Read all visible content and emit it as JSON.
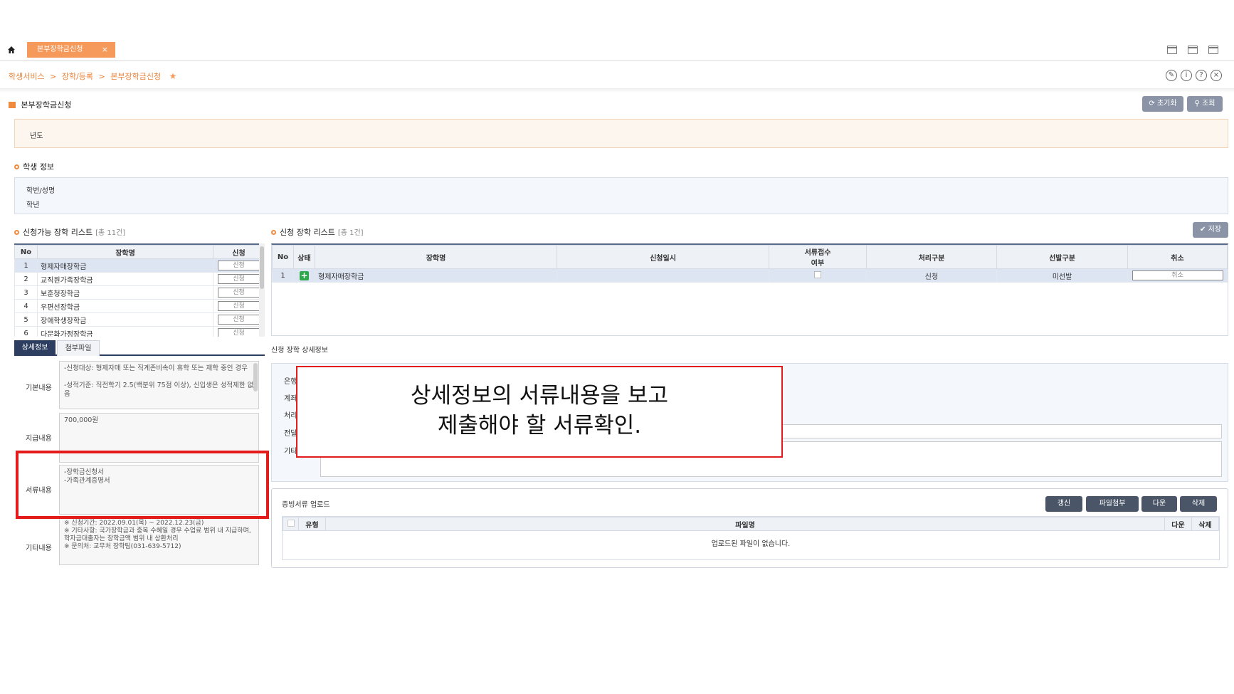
{
  "tabbar": {
    "home_icon": "home-icon",
    "active_tab": "본부장학금신청",
    "close_symbol": "×"
  },
  "breadcrumb": {
    "items": [
      "학생서비스",
      "장학/등록",
      "본부장학금신청"
    ],
    "separator": ">",
    "fav_symbol": "★"
  },
  "header_icons": {
    "edit": "✎",
    "info": "i",
    "help": "?",
    "close": "×"
  },
  "page": {
    "title": "본부장학금신청",
    "reset_button": "초기화",
    "search_button": "조회"
  },
  "search": {
    "year_label": "년도"
  },
  "student": {
    "section_title": "학생 정보",
    "id_name_label": "학번/성명",
    "grade_label": "학년"
  },
  "available_list": {
    "title": "신청가능 장학 리스트",
    "count": "[총 11건]",
    "headers": [
      "No",
      "장학명",
      "신청"
    ],
    "rows": [
      {
        "no": "1",
        "name": "형제자매장학금",
        "action": "신청"
      },
      {
        "no": "2",
        "name": "교직원가족장학금",
        "action": "신청"
      },
      {
        "no": "3",
        "name": "보훈청장학금",
        "action": "신청"
      },
      {
        "no": "4",
        "name": "우편선장학금",
        "action": "신청"
      },
      {
        "no": "5",
        "name": "장애학생장학금",
        "action": "신청"
      },
      {
        "no": "6",
        "name": "다문화가정장학금",
        "action": "신청"
      }
    ]
  },
  "applied_list": {
    "title": "신청 장학 리스트",
    "count": "[총 1건]",
    "save_button": "저장",
    "headers": {
      "no": "No",
      "status": "상태",
      "name": "장학명",
      "date": "신청일시",
      "doc_1": "서류접수",
      "doc_2": "여부",
      "process": "처리구분",
      "select": "선발구분",
      "cancel": "취소"
    },
    "rows": [
      {
        "no": "1",
        "name": "형제자매장학금",
        "date": "",
        "process": "신청",
        "select": "미선발",
        "cancel": "취소"
      }
    ]
  },
  "detail_tabs": {
    "detail": "상세정보",
    "attachment": "첨부파일"
  },
  "detail": {
    "basic_label": "기본내용",
    "basic_text": "-신청대상: 형제자매 또는 직계존비속이 휴학 또는 재학 중인 경우\n\n-성적기준: 직전학기 2.5(백분위 75점 이상), 신입생은 성적제한 없음",
    "pay_label": "지급내용",
    "pay_text": "700,000원",
    "doc_label": "서류내용",
    "doc_text": "-장학금신청서\n-가족관계증명서",
    "etc_label": "기타내용",
    "etc_text": "※ 신청기간: 2022.09.01(목) ~ 2022.12.23(금)\n※ 기타사항: 국가장학금과 중복 수혜일 경우 수업료 범위 내 지급하며, 학자금대출자는 장학금액 범위 내 상환처리\n※ 문의처: 교무처 장학팀(031-639-5712)"
  },
  "applied_detail": {
    "title": "신청 장학 상세정보",
    "labels": [
      "은행",
      "계좌",
      "처리",
      "전달",
      "기타"
    ]
  },
  "callout": {
    "line1": "상세정보의 서류내용을 보고",
    "line2": "제출해야 할 서류확인."
  },
  "upload": {
    "title": "증빙서류 업로드",
    "buttons": {
      "refresh": "갱신",
      "attach": "파일첨부",
      "download": "다운",
      "delete": "삭제"
    },
    "headers": {
      "type": "유형",
      "file": "파일명",
      "down": "다운",
      "del": "삭제"
    },
    "empty_text": "업로드된 파일이 없습니다."
  },
  "colors": {
    "accent_orange": "#f59a5b",
    "highlight_red": "#e31b1b",
    "navy": "#2e3e60",
    "add_green": "#2ea84a"
  }
}
